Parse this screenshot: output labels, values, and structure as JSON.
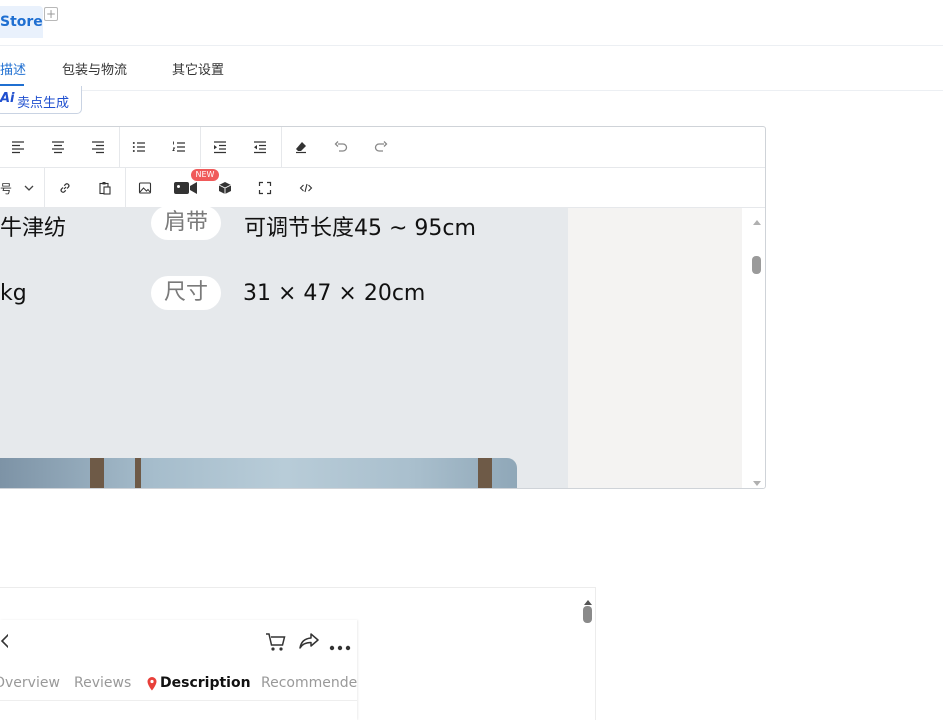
{
  "header": {
    "store_label": "Store",
    "add_tab_symbol": "+"
  },
  "subtabs": [
    {
      "label": "描述",
      "active": true
    },
    {
      "label": "包装与物流",
      "active": false
    },
    {
      "label": "其它设置",
      "active": false
    }
  ],
  "ai_button": {
    "badge": "Ai",
    "label": "卖点生成"
  },
  "toolbar": {
    "font_size_fragment": "号",
    "video_badge": "NEW"
  },
  "content": {
    "row1": {
      "left_text": "牛津纺",
      "pill": "肩带",
      "value": "可调节长度45 ~ 95cm"
    },
    "row2": {
      "left_text": "kg",
      "pill": "尺寸",
      "value": "31 × 47 × 20cm"
    }
  },
  "preview": {
    "tabs": [
      {
        "label": "Overview",
        "active": false
      },
      {
        "label": "Reviews",
        "active": false
      },
      {
        "label": "Description",
        "active": true
      },
      {
        "label": "Recommended",
        "active": false
      }
    ]
  },
  "colors": {
    "accent": "#1f6fd1",
    "badge": "#f05a5a",
    "ai": "#1f4fcf"
  }
}
